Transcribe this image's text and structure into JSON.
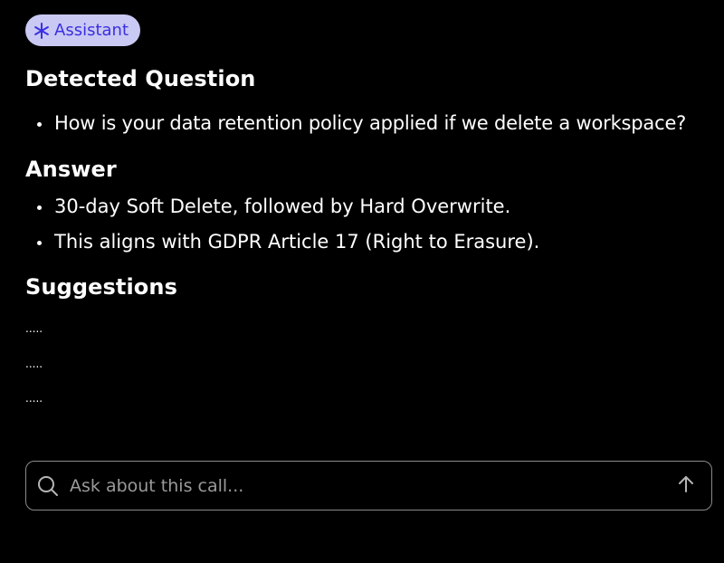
{
  "badge": {
    "label": "Assistant",
    "icon": "asterisk-icon",
    "bg_color": "#c9c9f3",
    "text_color": "#3b2fe0"
  },
  "detected_question": {
    "heading": "Detected Question",
    "items": [
      "How is your data retention policy applied if we delete a workspace?"
    ]
  },
  "answer": {
    "heading": "Answer",
    "items": [
      "30-day Soft Delete, followed by Hard Overwrite.",
      "This aligns with GDPR Article 17 (Right to Erasure)."
    ]
  },
  "suggestions": {
    "heading": "Suggestions",
    "items": [
      ".....",
      ".....",
      "....."
    ]
  },
  "input": {
    "placeholder": "Ask about this call...",
    "value": "",
    "leading_icon": "search-icon",
    "send_icon": "arrow-up-icon"
  }
}
